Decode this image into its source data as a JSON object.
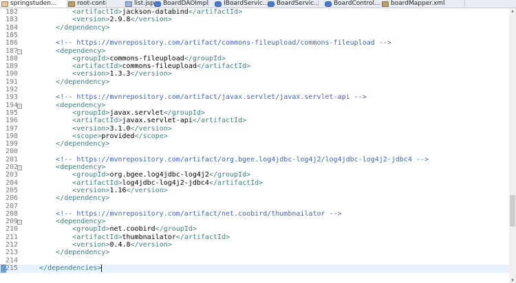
{
  "tabs": [
    {
      "label": "springstuden...",
      "icon": "maven-file-icon",
      "active": true
    },
    {
      "label": "root-contex...",
      "icon": "xml-file-icon",
      "active": false
    },
    {
      "label": "list.jsp",
      "icon": "jsp-file-icon",
      "active": false
    },
    {
      "label": "BoardDAOImpl...",
      "icon": "java-file-icon",
      "active": false
    },
    {
      "label": "IBoardServic...",
      "icon": "java-file-icon",
      "active": false
    },
    {
      "label": "BoardServic...",
      "icon": "java-file-icon",
      "active": false
    },
    {
      "label": "BoardControl...",
      "icon": "java-file-icon",
      "active": false
    },
    {
      "label": "boardMapper.xml",
      "icon": "xml-file-icon",
      "active": false
    }
  ],
  "editor": {
    "lines": [
      {
        "n": "182",
        "indent": "            ",
        "open": "<artifactId>",
        "text": "jackson-databind",
        "close": "</artifactId>"
      },
      {
        "n": "183",
        "indent": "            ",
        "open": "<version>",
        "text": "2.9.8",
        "close": "</version>"
      },
      {
        "n": "184",
        "indent": "        ",
        "open": "</dependency>",
        "text": "",
        "close": ""
      },
      {
        "n": "185",
        "indent": "",
        "open": "",
        "text": "",
        "close": ""
      },
      {
        "n": "186",
        "indent": "        ",
        "comment": "<!-- https://mvnrepository.com/artifact/commons-fileupload/commons-fileupload -->"
      },
      {
        "n": "187",
        "fold": true,
        "indent": "        ",
        "open": "<dependency>",
        "text": "",
        "close": ""
      },
      {
        "n": "188",
        "indent": "            ",
        "open": "<groupId>",
        "text": "commons-fileupload",
        "close": "</groupId>"
      },
      {
        "n": "189",
        "indent": "            ",
        "open": "<artifactId>",
        "text": "commons-fileupload",
        "close": "</artifactId>"
      },
      {
        "n": "190",
        "indent": "            ",
        "open": "<version>",
        "text": "1.3.3",
        "close": "</version>"
      },
      {
        "n": "191",
        "indent": "        ",
        "open": "</dependency>",
        "text": "",
        "close": ""
      },
      {
        "n": "192",
        "indent": "",
        "open": "",
        "text": "",
        "close": ""
      },
      {
        "n": "193",
        "indent": "        ",
        "comment": "<!-- https://mvnrepository.com/artifact/javax.servlet/javax.servlet-api -->"
      },
      {
        "n": "194",
        "fold": true,
        "indent": "        ",
        "open": "<dependency>",
        "text": "",
        "close": ""
      },
      {
        "n": "195",
        "indent": "            ",
        "open": "<groupId>",
        "text": "javax.servlet",
        "close": "</groupId>"
      },
      {
        "n": "196",
        "indent": "            ",
        "open": "<artifactId>",
        "text": "javax.servlet-api",
        "close": "</artifactId>"
      },
      {
        "n": "197",
        "indent": "            ",
        "open": "<version>",
        "text": "3.1.0",
        "close": "</version>"
      },
      {
        "n": "198",
        "indent": "            ",
        "open": "<scope>",
        "text": "provided",
        "close": "</scope>"
      },
      {
        "n": "199",
        "indent": "        ",
        "open": "</dependency>",
        "text": "",
        "close": ""
      },
      {
        "n": "200",
        "indent": "",
        "open": "",
        "text": "",
        "close": ""
      },
      {
        "n": "201",
        "indent": "        ",
        "comment": "<!-- https://mvnrepository.com/artifact/org.bgee.log4jdbc-log4j2/log4jdbc-log4j2-jdbc4 -->"
      },
      {
        "n": "202",
        "fold": true,
        "indent": "        ",
        "open": "<dependency>",
        "text": "",
        "close": ""
      },
      {
        "n": "203",
        "indent": "            ",
        "open": "<groupId>",
        "text": "org.bgee.log4jdbc-log4j2",
        "close": "</groupId>"
      },
      {
        "n": "204",
        "indent": "            ",
        "open": "<artifactId>",
        "text": "log4jdbc-log4j2-jdbc4",
        "close": "</artifactId>"
      },
      {
        "n": "205",
        "indent": "            ",
        "open": "<version>",
        "text": "1.16",
        "close": "</version>"
      },
      {
        "n": "206",
        "indent": "        ",
        "open": "</dependency>",
        "text": "",
        "close": ""
      },
      {
        "n": "207",
        "indent": "",
        "open": "",
        "text": "",
        "close": ""
      },
      {
        "n": "208",
        "indent": "        ",
        "comment": "<!-- https://mvnrepository.com/artifact/net.coobird/thumbnailator -->"
      },
      {
        "n": "209",
        "fold": true,
        "indent": "        ",
        "open": "<dependency>",
        "text": "",
        "close": ""
      },
      {
        "n": "210",
        "indent": "            ",
        "open": "<groupId>",
        "text": "net.coobird",
        "close": "</groupId>"
      },
      {
        "n": "211",
        "indent": "            ",
        "open": "<artifactId>",
        "text": "thumbnailator",
        "close": "</artifactId>"
      },
      {
        "n": "212",
        "indent": "            ",
        "open": "<version>",
        "text": "0.4.8",
        "close": "</version>"
      },
      {
        "n": "213",
        "indent": "        ",
        "open": "</dependency>",
        "text": "",
        "close": ""
      },
      {
        "n": "214",
        "indent": "",
        "open": "",
        "text": "",
        "close": ""
      },
      {
        "n": "215",
        "current": true,
        "indent": "    ",
        "open": "</dependencies>",
        "text": "",
        "close": ""
      }
    ]
  }
}
